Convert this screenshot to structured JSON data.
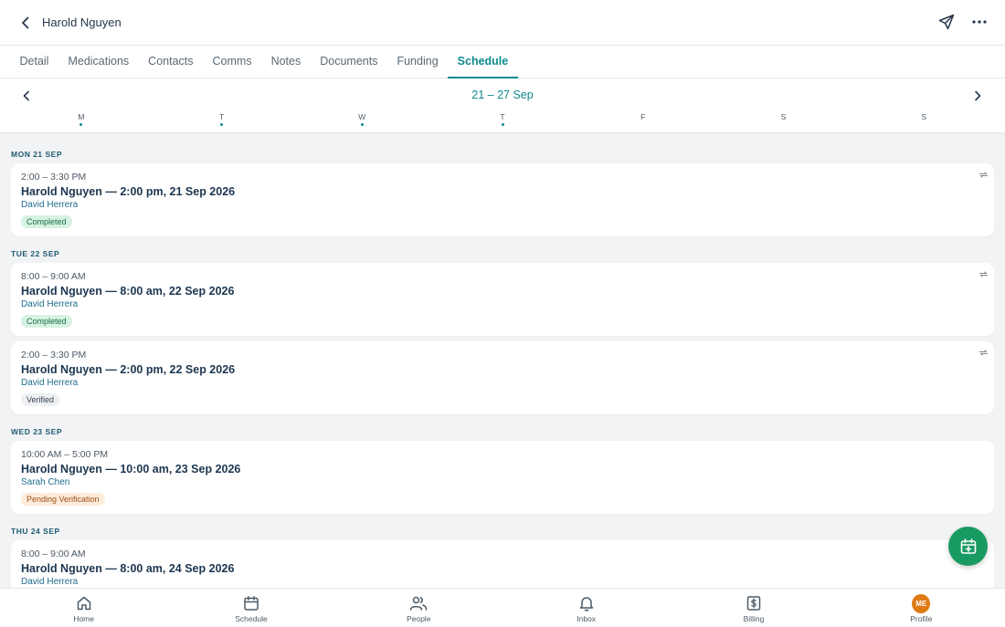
{
  "header": {
    "title": "Harold Nguyen"
  },
  "tabs": [
    {
      "label": "Detail",
      "active": false
    },
    {
      "label": "Medications",
      "active": false
    },
    {
      "label": "Contacts",
      "active": false
    },
    {
      "label": "Comms",
      "active": false
    },
    {
      "label": "Notes",
      "active": false
    },
    {
      "label": "Documents",
      "active": false
    },
    {
      "label": "Funding",
      "active": false
    },
    {
      "label": "Schedule",
      "active": true
    }
  ],
  "week": {
    "range": "21 – 27 Sep",
    "days": [
      {
        "letter": "M",
        "has_events": true
      },
      {
        "letter": "T",
        "has_events": true
      },
      {
        "letter": "W",
        "has_events": true
      },
      {
        "letter": "T",
        "has_events": true
      },
      {
        "letter": "F",
        "has_events": false
      },
      {
        "letter": "S",
        "has_events": false
      },
      {
        "letter": "S",
        "has_events": false
      }
    ]
  },
  "groups": [
    {
      "date": "MON 21 SEP",
      "items": [
        {
          "time": "2:00 – 3:30 PM",
          "title": "Harold Nguyen — 2:00 pm, 21 Sep 2026",
          "person": "David Herrera",
          "status": "Completed",
          "status_type": "completed",
          "recurring": true
        }
      ]
    },
    {
      "date": "TUE 22 SEP",
      "items": [
        {
          "time": "8:00 – 9:00 AM",
          "title": "Harold Nguyen — 8:00 am, 22 Sep 2026",
          "person": "David Herrera",
          "status": "Completed",
          "status_type": "completed",
          "recurring": true
        },
        {
          "time": "2:00 – 3:30 PM",
          "title": "Harold Nguyen — 2:00 pm, 22 Sep 2026",
          "person": "David Herrera",
          "status": "Verified",
          "status_type": "verified",
          "recurring": true
        }
      ]
    },
    {
      "date": "WED 23 SEP",
      "items": [
        {
          "time": "10:00 AM – 5:00 PM",
          "title": "Harold Nguyen — 10:00 am, 23 Sep 2026",
          "person": "Sarah Chen",
          "status": "Pending Verification",
          "status_type": "pending",
          "recurring": false
        }
      ]
    },
    {
      "date": "THU 24 SEP",
      "items": [
        {
          "time": "8:00 – 9:00 AM",
          "title": "Harold Nguyen — 8:00 am, 24 Sep 2026",
          "person": "David Herrera",
          "status": "",
          "status_type": "",
          "recurring": false
        }
      ]
    }
  ],
  "bottom_nav": [
    {
      "label": "Home",
      "icon": "home-icon"
    },
    {
      "label": "Schedule",
      "icon": "calendar-icon"
    },
    {
      "label": "People",
      "icon": "people-icon"
    },
    {
      "label": "Inbox",
      "icon": "bell-icon"
    },
    {
      "label": "Billing",
      "icon": "billing-icon"
    },
    {
      "label": "Profile",
      "icon": "avatar",
      "avatar_initials": "ME"
    }
  ],
  "colors": {
    "accent": "#0f8a8c",
    "fab": "#1a9a63",
    "avatar": "#e07a14"
  }
}
